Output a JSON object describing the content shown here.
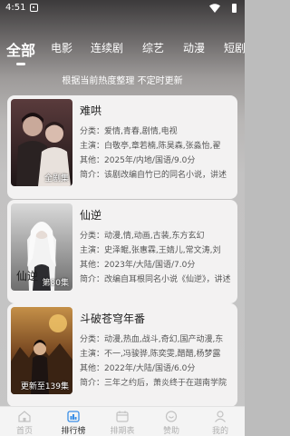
{
  "status": {
    "time": "4:51"
  },
  "tabs": [
    "全部",
    "电影",
    "连续剧",
    "综艺",
    "动漫",
    "短剧"
  ],
  "subtitle": "根据当前热度整理 不定时更新",
  "cards": [
    {
      "title": "难哄",
      "badge": "全剧集",
      "category": "分类：爱情,青春,剧情,电视",
      "cast": "主演：白敬亭,章若楠,陈昊森,张淼怡,翟",
      "other": "其他：2025年/内地/国语/9.0分",
      "intro": "简介：该剧改编自竹已的同名小说，讲述"
    },
    {
      "title": "仙逆",
      "badge": "第80集",
      "category": "分类：动漫,情,动画,古装,东方玄幻",
      "cast": "主演：史泽鲲,张惠霖,王婧儿,常文涛,刘",
      "other": "其他：2023年/大陆/国语/7.0分",
      "intro": "简介：改编自耳根同名小说《仙逆》，讲述"
    },
    {
      "title": "斗破苍穹年番",
      "badge": "更新至139集",
      "category": "分类：动漫,热血,战斗,奇幻,国产动漫,东",
      "cast": "主演：不一,冯骏骅,陈奕雯,醋醋,杨梦露",
      "other": "其他：2022年/大陆/国语/6.0分",
      "intro": "简介：三年之约后，萧炎终于在迦南学院"
    }
  ],
  "nav": [
    {
      "label": "首页",
      "icon": "home-icon"
    },
    {
      "label": "排行榜",
      "icon": "ranking-icon"
    },
    {
      "label": "排期表",
      "icon": "calendar-icon"
    },
    {
      "label": "赞助",
      "icon": "sponsor-icon"
    },
    {
      "label": "我的",
      "icon": "profile-icon"
    }
  ]
}
